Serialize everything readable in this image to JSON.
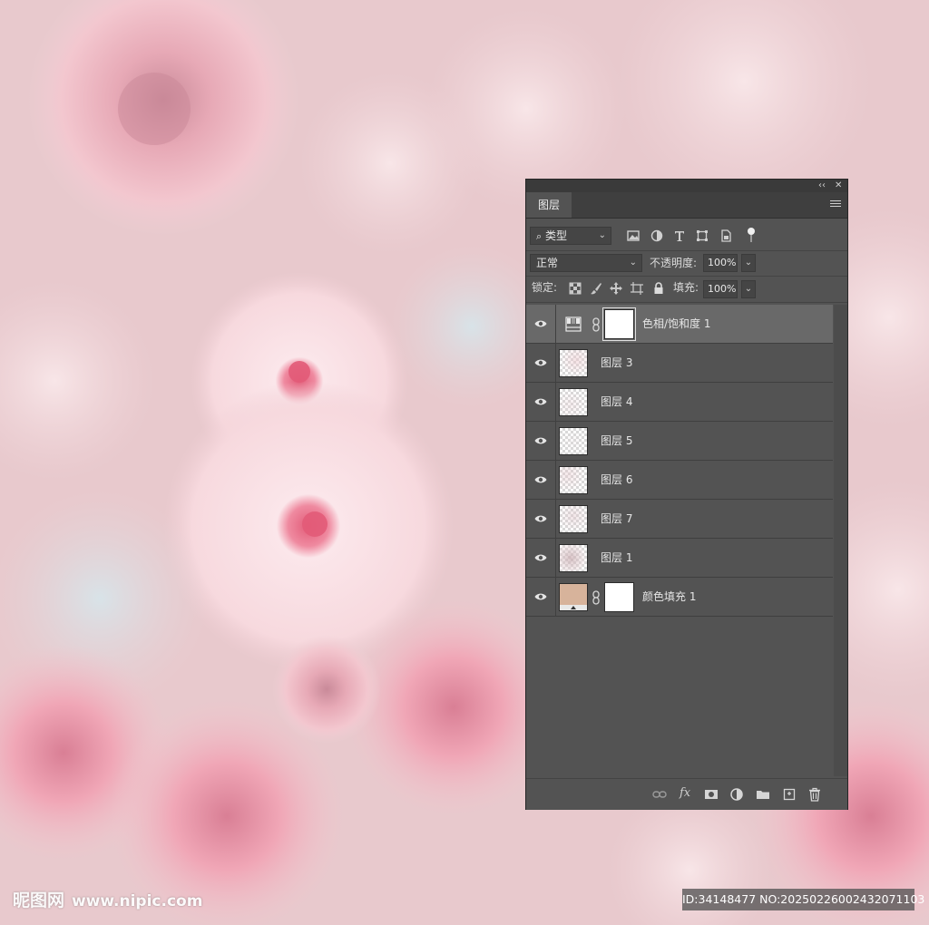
{
  "watermark": {
    "logo_text": "昵图网",
    "site": "www.nipic.com",
    "id_text": "ID:34148477 NO:20250226002432071103"
  },
  "panel": {
    "tab_label": "图层",
    "collapse_label": "‹‹",
    "close_label": "✕",
    "filter_dropdown": {
      "icon": "search-icon",
      "value": "类型"
    },
    "blend_mode": "正常",
    "opacity_label": "不透明度:",
    "opacity_value": "100%",
    "lock_label": "锁定:",
    "fill_label": "填充:",
    "fill_value": "100%",
    "layers": [
      {
        "name": "色相/饱和度 1",
        "type": "adjustment",
        "selected": true,
        "visible": true
      },
      {
        "name": "图层 3",
        "type": "pixel",
        "selected": false,
        "visible": true
      },
      {
        "name": "图层 4",
        "type": "pixel",
        "selected": false,
        "visible": true
      },
      {
        "name": "图层 5",
        "type": "pixel",
        "selected": false,
        "visible": true
      },
      {
        "name": "图层 6",
        "type": "pixel",
        "selected": false,
        "visible": true
      },
      {
        "name": "图层 7",
        "type": "pixel",
        "selected": false,
        "visible": true
      },
      {
        "name": "图层 1",
        "type": "pixel",
        "selected": false,
        "visible": true
      },
      {
        "name": "颜色填充 1",
        "type": "fill",
        "selected": false,
        "visible": true,
        "fill_color": "#d7b39b"
      }
    ],
    "bottom_icons": [
      "link-icon",
      "fx-icon",
      "mask-icon",
      "adjustment-icon",
      "folder-icon",
      "new-layer-icon",
      "trash-icon"
    ],
    "fx_label": "fx"
  }
}
